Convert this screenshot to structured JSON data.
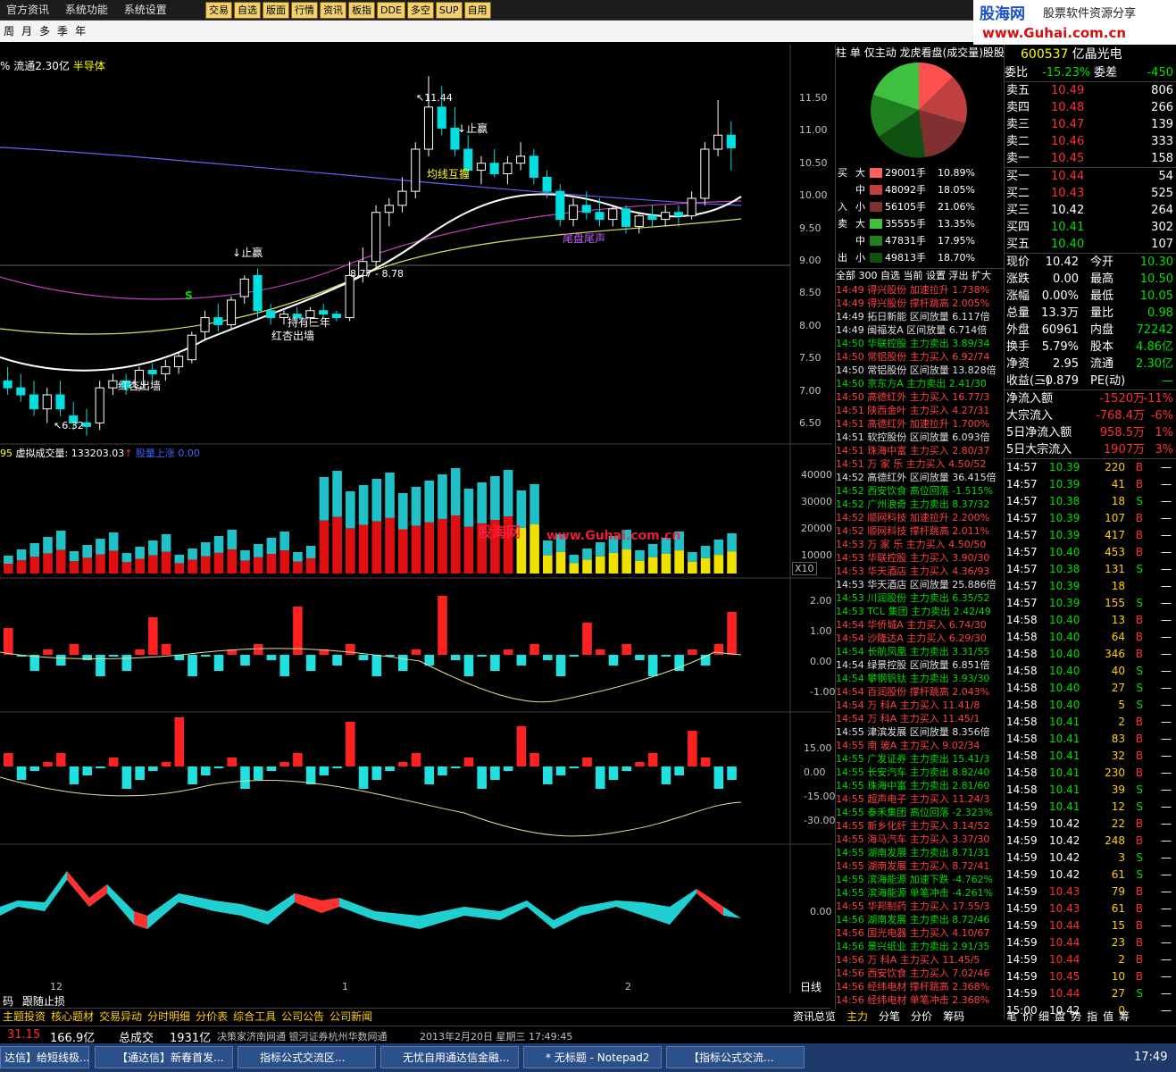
{
  "menu": [
    "官方资讯",
    "系统功能",
    "系统设置"
  ],
  "tabs": [
    "交易",
    "自选",
    "版面",
    "行情",
    "资讯",
    "板指",
    "DDE",
    "多空",
    "SUP",
    "自用"
  ],
  "logo": {
    "name": "股海网",
    "slogan": "股票软件资源分享",
    "url": "www.Guhai.com.cn"
  },
  "periods": [
    "周",
    "月",
    "多",
    "季",
    "年"
  ],
  "chart_header": {
    "float": "% 流通2.30亿",
    "sector": "半导体"
  },
  "price_axis": [
    "11.50",
    "11.00",
    "10.50",
    "10.00",
    "9.50",
    "9.00",
    "8.50",
    "8.00",
    "7.50",
    "7.00",
    "6.50"
  ],
  "annotations": {
    "high": "11.44",
    "low": "6.32",
    "stop1": "止赢",
    "stop2": "止赢",
    "ma_cross": "均线互握",
    "range": "8.77 - 8.78",
    "gold_wall": "红杏出墙",
    "gold_wall2": "红杏出墙",
    "tail": "尾盘尾声",
    "hold": "持有三年",
    "s": "S"
  },
  "vol_header": {
    "n": "95",
    "label": "虚拟成交量: 133203.03",
    "extra": "股量上涨 0.00"
  },
  "vol_axis": [
    "40000",
    "30000",
    "20000",
    "10000"
  ],
  "vol_unit": "X10",
  "ind1_axis": [
    "2.00",
    "1.00",
    "0.00",
    "-1.00"
  ],
  "ind2_axis": [
    "15.00",
    "0.00",
    "-15.00",
    "-30.00"
  ],
  "ind3_axis": [
    "0.00"
  ],
  "watermark": {
    "a": "股海网",
    "b": "www.Guhai.com.cn"
  },
  "x_labels": [
    "12",
    "1",
    "2"
  ],
  "day_label": "日线",
  "chart_data": {
    "type": "candlestick",
    "y_range": [
      6.2,
      11.8
    ],
    "candles": [
      [
        7.1,
        7.3,
        6.9,
        7.0
      ],
      [
        7.0,
        7.2,
        6.8,
        6.9
      ],
      [
        6.9,
        7.1,
        6.6,
        6.7
      ],
      [
        6.7,
        7.0,
        6.5,
        6.9
      ],
      [
        6.9,
        7.1,
        6.6,
        6.7
      ],
      [
        6.6,
        6.8,
        6.4,
        6.5
      ],
      [
        6.5,
        6.7,
        6.32,
        6.45
      ],
      [
        6.5,
        7.1,
        6.4,
        7.0
      ],
      [
        7.0,
        7.2,
        6.9,
        7.1
      ],
      [
        7.1,
        7.2,
        6.9,
        7.0
      ],
      [
        7.0,
        7.3,
        6.95,
        7.25
      ],
      [
        7.25,
        7.35,
        7.1,
        7.2
      ],
      [
        7.2,
        7.4,
        7.1,
        7.3
      ],
      [
        7.3,
        7.5,
        7.2,
        7.45
      ],
      [
        7.4,
        7.8,
        7.35,
        7.75
      ],
      [
        7.8,
        8.1,
        7.7,
        8.0
      ],
      [
        8.0,
        8.2,
        7.8,
        7.9
      ],
      [
        7.9,
        8.3,
        7.85,
        8.25
      ],
      [
        8.3,
        8.6,
        8.2,
        8.55
      ],
      [
        8.6,
        8.7,
        8.0,
        8.1
      ],
      [
        8.1,
        8.2,
        7.9,
        8.0
      ],
      [
        8.0,
        8.1,
        7.9,
        8.05
      ],
      [
        8.05,
        8.15,
        7.95,
        8.0
      ],
      [
        8.0,
        8.15,
        7.9,
        8.1
      ],
      [
        8.1,
        8.2,
        8.0,
        8.05
      ],
      [
        8.05,
        8.1,
        7.95,
        8.0
      ],
      [
        8.0,
        8.8,
        7.95,
        8.6
      ],
      [
        8.6,
        9.0,
        8.5,
        8.8
      ],
      [
        8.8,
        9.6,
        8.7,
        9.5
      ],
      [
        9.5,
        9.7,
        9.3,
        9.6
      ],
      [
        9.6,
        10.0,
        9.5,
        9.8
      ],
      [
        9.8,
        10.5,
        9.7,
        10.4
      ],
      [
        10.4,
        11.44,
        10.3,
        11.0
      ],
      [
        11.0,
        11.3,
        10.6,
        10.7
      ],
      [
        10.7,
        11.0,
        10.3,
        10.4
      ],
      [
        10.4,
        10.6,
        10.0,
        10.1
      ],
      [
        10.1,
        10.3,
        9.9,
        10.2
      ],
      [
        10.2,
        10.4,
        10.0,
        10.05
      ],
      [
        10.05,
        10.3,
        9.9,
        10.2
      ],
      [
        10.2,
        10.5,
        10.1,
        10.3
      ],
      [
        10.3,
        10.4,
        9.9,
        10.0
      ],
      [
        10.0,
        10.1,
        9.7,
        9.8
      ],
      [
        9.8,
        9.9,
        9.3,
        9.4
      ],
      [
        9.4,
        9.7,
        9.3,
        9.6
      ],
      [
        9.6,
        9.8,
        9.4,
        9.5
      ],
      [
        9.5,
        9.7,
        9.3,
        9.4
      ],
      [
        9.4,
        9.6,
        9.3,
        9.55
      ],
      [
        9.55,
        9.6,
        9.2,
        9.3
      ],
      [
        9.3,
        9.5,
        9.2,
        9.45
      ],
      [
        9.45,
        9.6,
        9.3,
        9.4
      ],
      [
        9.4,
        9.6,
        9.3,
        9.5
      ],
      [
        9.5,
        9.6,
        9.3,
        9.45
      ],
      [
        9.45,
        9.8,
        9.4,
        9.7
      ],
      [
        9.7,
        10.5,
        9.6,
        10.4
      ],
      [
        10.4,
        11.1,
        10.3,
        10.6
      ],
      [
        10.6,
        10.8,
        10.1,
        10.42
      ]
    ]
  },
  "right_header": {
    "tabs": [
      "柱",
      "单",
      "仅主动",
      "龙虎看盘(成交量)股股"
    ]
  },
  "buy_sell": [
    {
      "side": "买",
      "size": "大",
      "vol": "29001手",
      "pct": "10.89%",
      "color": "#ff6060"
    },
    {
      "side": "",
      "size": "中",
      "vol": "48092手",
      "pct": "18.05%",
      "color": "#c04040"
    },
    {
      "side": "入",
      "size": "小",
      "vol": "56105手",
      "pct": "21.06%",
      "color": "#803030"
    },
    {
      "side": "卖",
      "size": "大",
      "vol": "35555手",
      "pct": "13.35%",
      "color": "#40c040"
    },
    {
      "side": "",
      "size": "中",
      "vol": "47831手",
      "pct": "17.95%",
      "color": "#208020"
    },
    {
      "side": "出",
      "size": "小",
      "vol": "49813手",
      "pct": "18.70%",
      "color": "#105010"
    }
  ],
  "flow_tabs": [
    "全部",
    "300",
    "自选",
    "当前",
    "设置",
    "浮出",
    "扩大"
  ],
  "flow_rows": [
    [
      "14:49",
      "得兴股份",
      "加速拉升",
      "1.738%",
      "r"
    ],
    [
      "14:49",
      "得兴股份",
      "撑杆跳高",
      "2.005%",
      "r"
    ],
    [
      "14:49",
      "拓日新能",
      "区间放量",
      "6.117倍",
      "w"
    ],
    [
      "14:49",
      "闽福发A",
      "区间放量",
      "6.714倍",
      "w"
    ],
    [
      "14:50",
      "华联控股",
      "主力卖出",
      "3.89/34",
      "g"
    ],
    [
      "14:50",
      "常铝股份",
      "主力买入",
      "6.92/74",
      "r"
    ],
    [
      "14:50",
      "常铝股份",
      "区间放量",
      "13.828倍",
      "w"
    ],
    [
      "14:50",
      "京东方A",
      "主力卖出",
      "2.41/30",
      "g"
    ],
    [
      "14:50",
      "高德红外",
      "主力买入",
      "16.77/3",
      "r"
    ],
    [
      "14:51",
      "陕西金叶",
      "主力买入",
      "4.27/31",
      "r"
    ],
    [
      "14:51",
      "高德红外",
      "加速拉升",
      "1.700%",
      "r"
    ],
    [
      "14:51",
      "软控股份",
      "区间放量",
      "6.093倍",
      "w"
    ],
    [
      "14:51",
      "珠海中富",
      "主力买入",
      "2.80/37",
      "r"
    ],
    [
      "14:51",
      "万 家 乐",
      "主力买入",
      "4.50/52",
      "r"
    ],
    [
      "14:52",
      "高德红外",
      "区间放量",
      "36.415倍",
      "w"
    ],
    [
      "14:52",
      "西安饮食",
      "高位回落",
      "-1.515%",
      "g"
    ],
    [
      "14:52",
      "广州浪奇",
      "主力卖出",
      "8.37/32",
      "g"
    ],
    [
      "14:52",
      "顺网科技",
      "加速拉升",
      "2.200%",
      "r"
    ],
    [
      "14:52",
      "顺网科技",
      "撑杆跳高",
      "2.011%",
      "r"
    ],
    [
      "14:53",
      "万 家 乐",
      "主力买入",
      "4.50/50",
      "r"
    ],
    [
      "14:53",
      "华联控股",
      "主力买入",
      "3.90/30",
      "r"
    ],
    [
      "14:53",
      "华天酒店",
      "主力买入",
      "4.36/93",
      "r"
    ],
    [
      "14:53",
      "华天酒店",
      "区间放量",
      "25.886倍",
      "w"
    ],
    [
      "14:53",
      "川润股份",
      "主力卖出",
      "6.35/52",
      "g"
    ],
    [
      "14:53",
      "TCL 集团",
      "主力卖出",
      "2.42/49",
      "g"
    ],
    [
      "14:54",
      "华侨城A",
      "主力买入",
      "6.74/30",
      "r"
    ],
    [
      "14:54",
      "沙隆达A",
      "主力买入",
      "6.29/30",
      "r"
    ],
    [
      "14:54",
      "长航凤凰",
      "主力卖出",
      "3.31/55",
      "g"
    ],
    [
      "14:54",
      "绿景控股",
      "区间放量",
      "6.851倍",
      "w"
    ],
    [
      "14:54",
      "攀钢钒钛",
      "主力卖出",
      "3.93/30",
      "g"
    ],
    [
      "14:54",
      "百润股份",
      "撑杆跳高",
      "2.043%",
      "r"
    ],
    [
      "14:54",
      "万 科A",
      "主力买入",
      "11.41/8",
      "r"
    ],
    [
      "14:54",
      "万 科A",
      "主力买入",
      "11.45/1",
      "r"
    ],
    [
      "14:55",
      "津滨发展",
      "区间放量",
      "8.356倍",
      "w"
    ],
    [
      "14:55",
      "南 玻A",
      "主力买入",
      "9.02/34",
      "r"
    ],
    [
      "14:55",
      "广发证券",
      "主力卖出",
      "15.41/3",
      "g"
    ],
    [
      "14:55",
      "长安汽车",
      "主力卖出",
      "8.82/40",
      "g"
    ],
    [
      "14:55",
      "珠海中富",
      "主力卖出",
      "2.81/60",
      "g"
    ],
    [
      "14:55",
      "超声电子",
      "主力买入",
      "11.24/3",
      "r"
    ],
    [
      "14:55",
      "泰禾集团",
      "高位回落",
      "-2.323%",
      "g"
    ],
    [
      "14:55",
      "新乡化纤",
      "主力买入",
      "3.14/52",
      "r"
    ],
    [
      "14:55",
      "海马汽车",
      "主力买入",
      "3.37/30",
      "r"
    ],
    [
      "14:55",
      "湖南发展",
      "主力卖出",
      "8.71/31",
      "g"
    ],
    [
      "14:55",
      "湖南发展",
      "主力买入",
      "8.72/41",
      "r"
    ],
    [
      "14:55",
      "滨海能源",
      "加速下跌",
      "-4.762%",
      "g"
    ],
    [
      "14:55",
      "滨海能源",
      "单笔冲击",
      "-4.261%",
      "g"
    ],
    [
      "14:55",
      "华邦制药",
      "主力买入",
      "17.55/3",
      "r"
    ],
    [
      "14:56",
      "湖南发展",
      "主力卖出",
      "8.72/46",
      "g"
    ],
    [
      "14:56",
      "国光电器",
      "主力买入",
      "4.10/67",
      "r"
    ],
    [
      "14:56",
      "景兴纸业",
      "主力卖出",
      "2.91/35",
      "g"
    ],
    [
      "14:56",
      "万 科A",
      "主力买入",
      "11.45/5",
      "r"
    ],
    [
      "14:56",
      "西安饮食",
      "主力买入",
      "7.02/46",
      "r"
    ],
    [
      "14:56",
      "经纬电材",
      "撑杆跳高",
      "2.368%",
      "r"
    ],
    [
      "14:56",
      "经纬电材",
      "单笔冲击",
      "2.368%",
      "r"
    ]
  ],
  "quote": {
    "code": "600537",
    "name": "亿晶光电",
    "wb_label": "委比",
    "wb": "-15.23%",
    "wc_label": "委差",
    "wc": "-450",
    "asks": [
      [
        "卖五",
        "10.49",
        "806"
      ],
      [
        "卖四",
        "10.48",
        "266"
      ],
      [
        "卖三",
        "10.47",
        "139"
      ],
      [
        "卖二",
        "10.46",
        "333"
      ],
      [
        "卖一",
        "10.45",
        "158"
      ]
    ],
    "bids": [
      [
        "买一",
        "10.44",
        "54"
      ],
      [
        "买二",
        "10.43",
        "525"
      ],
      [
        "买三",
        "10.42",
        "264"
      ],
      [
        "买四",
        "10.41",
        "302"
      ],
      [
        "买五",
        "10.40",
        "107"
      ]
    ],
    "stats": [
      [
        "现价",
        "10.42",
        "今开",
        "10.30"
      ],
      [
        "涨跌",
        "0.00",
        "最高",
        "10.50"
      ],
      [
        "涨幅",
        "0.00%",
        "最低",
        "10.05"
      ],
      [
        "总量",
        "13.3万",
        "量比",
        "0.98"
      ],
      [
        "外盘",
        "60961",
        "内盘",
        "72242"
      ],
      [
        "换手",
        "5.79%",
        "股本",
        "4.86亿"
      ],
      [
        "净资",
        "2.95",
        "流通",
        "2.30亿"
      ],
      [
        "收益(三)",
        "-0.879",
        "PE(动)",
        "—"
      ]
    ],
    "flows": [
      [
        "净流入额",
        "-1520万",
        "-11%"
      ],
      [
        "大宗流入",
        "-768.4万",
        "-6%"
      ],
      [
        "5日净流入额",
        "958.5万",
        "1%"
      ],
      [
        "5日大宗流入",
        "1907万",
        "3%"
      ]
    ]
  },
  "ticks": [
    [
      "14:57",
      "10.39",
      "220",
      "B"
    ],
    [
      "14:57",
      "10.39",
      "41",
      "B"
    ],
    [
      "14:57",
      "10.38",
      "18",
      "S"
    ],
    [
      "14:57",
      "10.39",
      "107",
      "B"
    ],
    [
      "14:57",
      "10.39",
      "417",
      "B"
    ],
    [
      "14:57",
      "10.40",
      "453",
      "B"
    ],
    [
      "14:57",
      "10.38",
      "131",
      "S"
    ],
    [
      "14:57",
      "10.39",
      "18",
      ""
    ],
    [
      "14:57",
      "10.39",
      "155",
      "S"
    ],
    [
      "14:58",
      "10.40",
      "13",
      "B"
    ],
    [
      "14:58",
      "10.40",
      "64",
      "B"
    ],
    [
      "14:58",
      "10.40",
      "346",
      "B"
    ],
    [
      "14:58",
      "10.40",
      "40",
      "S"
    ],
    [
      "14:58",
      "10.40",
      "27",
      "S"
    ],
    [
      "14:58",
      "10.40",
      "5",
      "S"
    ],
    [
      "14:58",
      "10.41",
      "2",
      "B"
    ],
    [
      "14:58",
      "10.41",
      "83",
      "B"
    ],
    [
      "14:58",
      "10.41",
      "32",
      "B"
    ],
    [
      "14:58",
      "10.41",
      "230",
      "B"
    ],
    [
      "14:58",
      "10.41",
      "39",
      "S"
    ],
    [
      "14:59",
      "10.41",
      "12",
      "S"
    ],
    [
      "14:59",
      "10.42",
      "22",
      "B"
    ],
    [
      "14:59",
      "10.42",
      "248",
      "B"
    ],
    [
      "14:59",
      "10.42",
      "3",
      "S"
    ],
    [
      "14:59",
      "10.42",
      "61",
      "S"
    ],
    [
      "14:59",
      "10.43",
      "79",
      "B"
    ],
    [
      "14:59",
      "10.43",
      "61",
      "B"
    ],
    [
      "14:59",
      "10.44",
      "15",
      "B"
    ],
    [
      "14:59",
      "10.44",
      "23",
      "B"
    ],
    [
      "14:59",
      "10.44",
      "2",
      "B"
    ],
    [
      "14:59",
      "10.45",
      "10",
      "B"
    ],
    [
      "14:59",
      "10.44",
      "27",
      "S"
    ],
    [
      "15:00",
      "10.42",
      "0",
      ""
    ]
  ],
  "bottom_tabs": [
    "码",
    "跟随止损"
  ],
  "bottom_links": [
    "主题投资",
    "核心题材",
    "交易异动",
    "分时明细",
    "分价表",
    "综合工具",
    "公司公告",
    "公司新闻"
  ],
  "right_bottom_tabs": [
    "资讯总览",
    "主力",
    "分笔",
    "分价",
    "筹码"
  ],
  "right_bottom_tabs2": [
    "笔",
    "价",
    "细",
    "盘",
    "势",
    "指",
    "值",
    "筹"
  ],
  "status": {
    "val1": "31.15",
    "val2": "166.9亿",
    "label": "总成交",
    "val3": "1931亿",
    "ticker": "决策家济南网通 银河证券杭州华数网通",
    "datetime": "2013年2月20日 星期三 17:49:45"
  },
  "taskbar": [
    "达信】给短线极...",
    "【通达信】新春首发...",
    "指标公式交流区...",
    "无忧自用通达信金融...",
    "* 无标题 - Notepad2",
    "【指标公式交流..."
  ],
  "clock": "17:49"
}
